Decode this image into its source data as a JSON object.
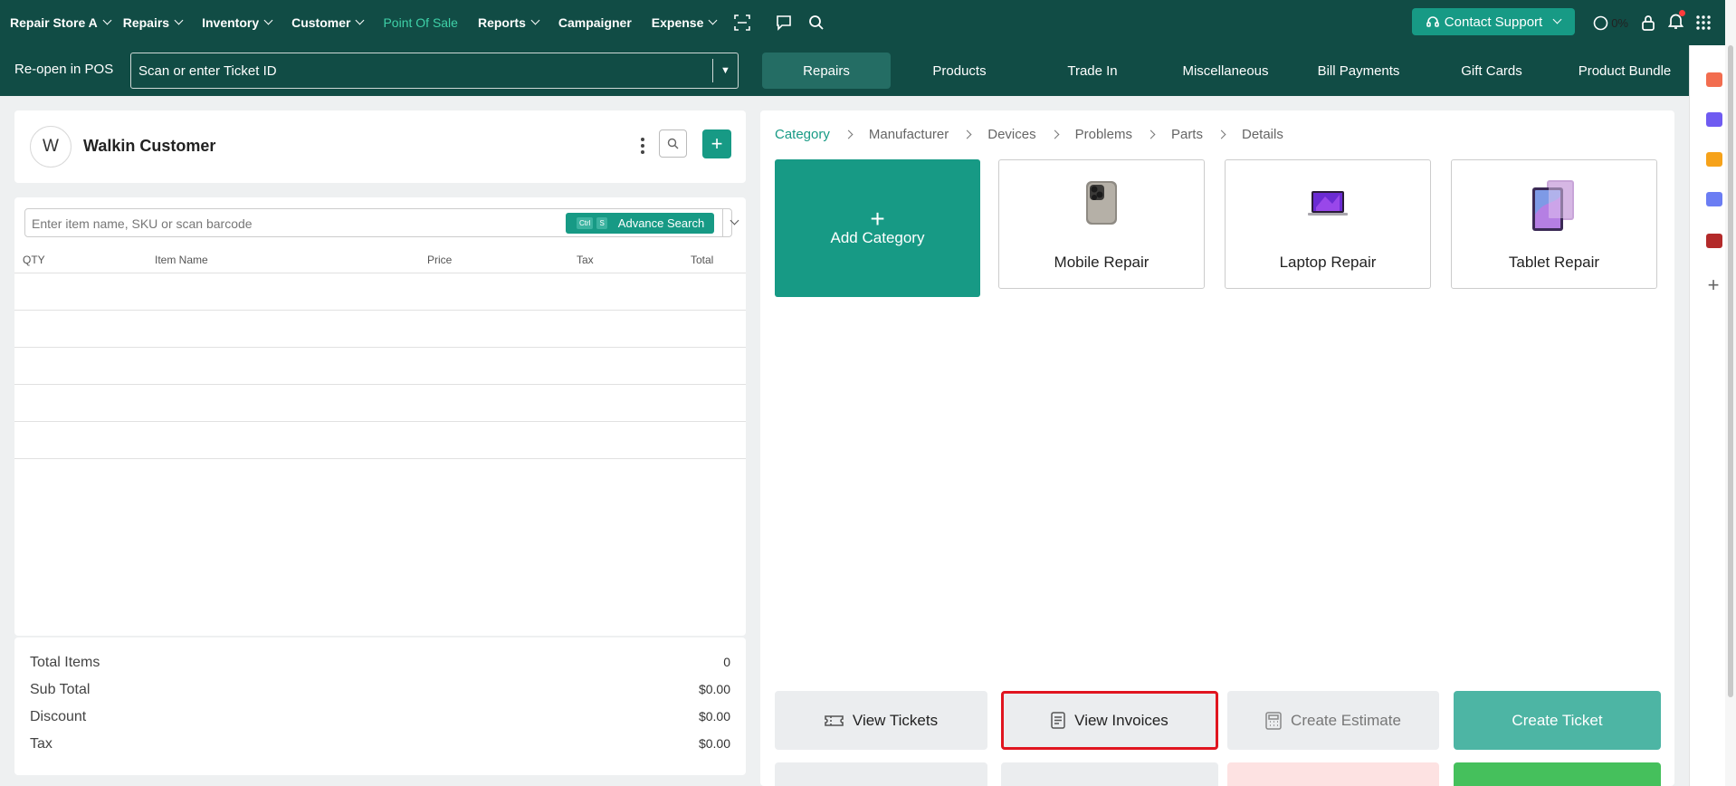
{
  "topnav": {
    "items": [
      {
        "label": "Repair Store A",
        "has_menu": true
      },
      {
        "label": "Repairs",
        "has_menu": true
      },
      {
        "label": "Inventory",
        "has_menu": true
      },
      {
        "label": "Customer",
        "has_menu": true
      },
      {
        "label": "Point Of Sale",
        "has_menu": false,
        "active": true
      },
      {
        "label": "Reports",
        "has_menu": true
      },
      {
        "label": "Campaigner",
        "has_menu": false
      },
      {
        "label": "Expense",
        "has_menu": true
      }
    ],
    "contact_label": "Contact Support",
    "progress": "0%"
  },
  "subbar": {
    "reopen_label": "Re-open in POS",
    "ticket_placeholder": "Scan or enter Ticket ID",
    "tabs": [
      "Repairs",
      "Products",
      "Trade In",
      "Miscellaneous",
      "Bill Payments",
      "Gift Cards",
      "Product Bundle"
    ]
  },
  "customer": {
    "initial": "W",
    "name": "Walkin Customer"
  },
  "cart": {
    "search_placeholder": "Enter item name, SKU or scan barcode",
    "adv_key1": "Ctrl",
    "adv_key2": "S",
    "adv_label": "Advance Search",
    "columns": [
      "QTY",
      "Item Name",
      "Price",
      "Tax",
      "Total"
    ]
  },
  "totals": {
    "items": [
      {
        "label": "Total Items",
        "value": "0"
      },
      {
        "label": "Sub Total",
        "value": "$0.00"
      },
      {
        "label": "Discount",
        "value": "$0.00"
      },
      {
        "label": "Tax",
        "value": "$0.00"
      }
    ]
  },
  "breadcrumb": [
    "Category",
    "Manufacturer",
    "Devices",
    "Problems",
    "Parts",
    "Details"
  ],
  "categories": {
    "add_label": "Add Category",
    "cards": [
      "Mobile Repair",
      "Laptop Repair",
      "Tablet Repair"
    ]
  },
  "actions": {
    "view_tickets": "View Tickets",
    "view_invoices": "View Invoices",
    "create_estimate": "Create Estimate",
    "create_ticket": "Create Ticket"
  },
  "colors": {
    "nav_bg": "#114c45",
    "accent": "#179a85",
    "active_nav": "#3fd1a8",
    "highlight": "#e0151f"
  }
}
